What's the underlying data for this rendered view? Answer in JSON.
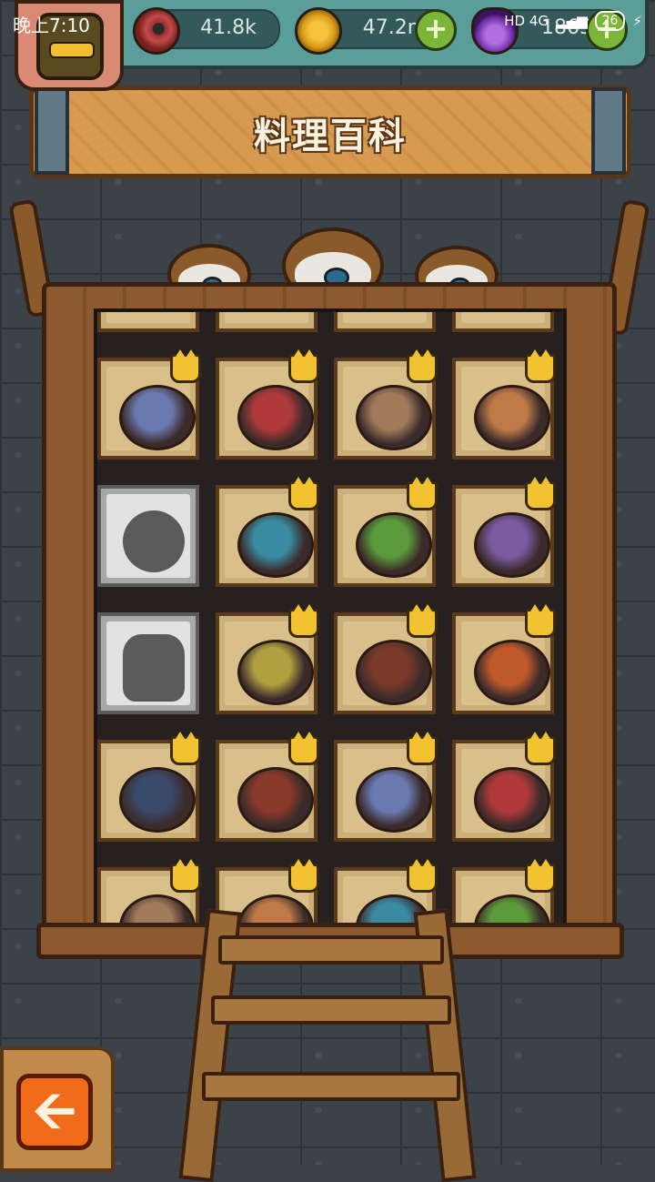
{
  "status_bar": {
    "time": "晚上7:10",
    "network": "HD 4G",
    "battery": "26"
  },
  "resources": {
    "eyes": "41.8k",
    "coins": "47.2m",
    "potions": "1863"
  },
  "title": "料理百科",
  "icons": {
    "eye": "eye-icon",
    "coin": "coin-icon",
    "potion": "potion-icon",
    "plus": "+",
    "back": "🡨"
  },
  "colors": {
    "banner": "#d69a50",
    "frame": "#8c5a2e",
    "back_button": "#f06a1a",
    "plus_button": "#7bb63a",
    "crown": "#f2c230"
  },
  "recipe_grid": {
    "rows": [
      [
        {
          "state": "unlocked",
          "crown": true,
          "dish": "glass-dome-dish"
        },
        {
          "state": "unlocked",
          "crown": true,
          "dish": "cup-dessert"
        },
        {
          "state": "unlocked",
          "crown": true,
          "dish": "jar-drink"
        },
        {
          "state": "unlocked",
          "crown": true,
          "dish": "cake-plate"
        }
      ],
      [
        {
          "state": "locked",
          "crown": false,
          "dish": "unknown-bowl"
        },
        {
          "state": "unlocked",
          "crown": true,
          "dish": "green-salad"
        },
        {
          "state": "unlocked",
          "crown": true,
          "dish": "stuffed-plate"
        },
        {
          "state": "unlocked",
          "crown": true,
          "dish": "meat-bowl"
        }
      ],
      [
        {
          "state": "locked",
          "crown": false,
          "dish": "unknown-cake"
        },
        {
          "state": "unlocked",
          "crown": true,
          "dish": "salad-bowl"
        },
        {
          "state": "unlocked",
          "crown": true,
          "dish": "purple-platter"
        },
        {
          "state": "unlocked",
          "crown": true,
          "dish": "pizza-slices"
        }
      ],
      [
        {
          "state": "unlocked",
          "crown": true,
          "dish": "eye-soup"
        },
        {
          "state": "unlocked",
          "crown": true,
          "dish": "roast-fish"
        },
        {
          "state": "unlocked",
          "crown": true,
          "dish": "skewer-tray"
        },
        {
          "state": "unlocked",
          "crown": true,
          "dish": "roast-bird"
        }
      ],
      [
        {
          "state": "unlocked",
          "crown": true,
          "dish": "partial-dish-1"
        },
        {
          "state": "unlocked",
          "crown": true,
          "dish": "partial-dish-2"
        },
        {
          "state": "unlocked",
          "crown": true,
          "dish": "partial-dish-3"
        },
        {
          "state": "unlocked",
          "crown": true,
          "dish": "partial-dish-4"
        }
      ]
    ]
  }
}
